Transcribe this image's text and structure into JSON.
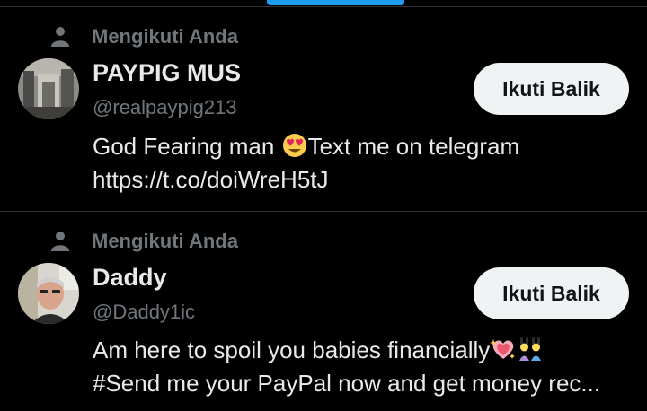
{
  "tabs": {
    "active_indicator_color": "#1d9bf0"
  },
  "users": [
    {
      "follows_you_label": "Mengikuti Anda",
      "name": "PAYPIG MUS",
      "handle": "@realpaypig213",
      "follow_button_label": "Ikuti Balik",
      "bio_line1_a": "God Fearing man ",
      "bio_line1_emoji": "smiling-face-with-heart-eyes",
      "bio_line1_b": "Text me on telegram",
      "bio_line2": "https://t.co/doiWreH5tJ"
    },
    {
      "follows_you_label": "Mengikuti Anda",
      "name": "Daddy",
      "handle": "@Daddy1ic",
      "follow_button_label": "Ikuti Balik",
      "bio_line1_a": "Am here to spoil you babies financially",
      "bio_line1_emoji": "sparkling-heart",
      "bio_line1_emoji2": "people-with-bunny-ears",
      "bio_line2": "#Send me your PayPal now and get money rec..."
    }
  ],
  "colors": {
    "background": "#000000",
    "primary_text": "#e7e9ea",
    "secondary_text": "#71767b",
    "button_bg": "#eff3f4",
    "divider": "#2f3336"
  }
}
